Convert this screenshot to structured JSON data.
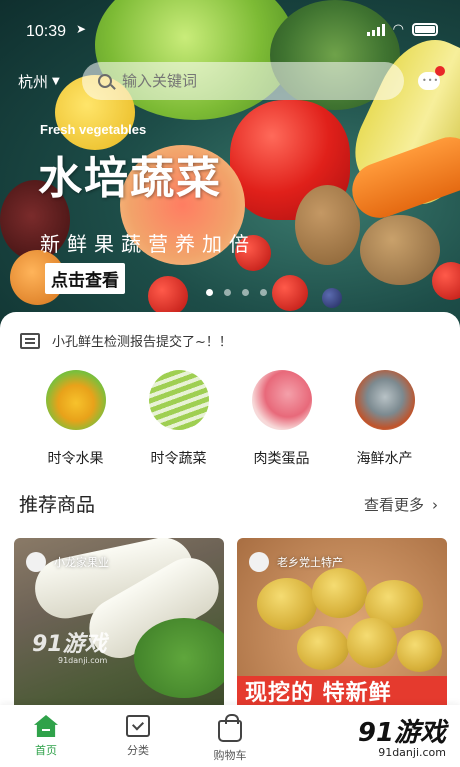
{
  "status_bar": {
    "time": "10:39"
  },
  "header": {
    "city": "杭州",
    "search_placeholder": "输入关键词"
  },
  "banner": {
    "eyebrow": "Fresh vegetables",
    "headline": "水培蔬菜",
    "subline": "新鲜果蔬营养加倍",
    "cta": "点击查看",
    "slide_count": 4,
    "active_slide": 1
  },
  "notice": {
    "text": "小孔鲜生检测报告提交了~！！"
  },
  "categories": [
    {
      "label": "时令水果",
      "icon": "fruit-image"
    },
    {
      "label": "时令蔬菜",
      "icon": "vegetable-image"
    },
    {
      "label": "肉类蛋品",
      "icon": "meat-egg-image"
    },
    {
      "label": "海鲜水产",
      "icon": "seafood-image"
    }
  ],
  "recommend": {
    "title": "推荐商品",
    "more": "查看更多",
    "products": [
      {
        "seller": "小龙家果业",
        "promo": ""
      },
      {
        "seller": "老乡党土特产",
        "promo": "现挖的 特新鲜"
      }
    ]
  },
  "watermarks": {
    "left_brand": "91游戏",
    "left_url": "91danji.com",
    "right_brand": "91游戏",
    "right_url": "91danji.com"
  },
  "tabs": [
    {
      "label": "首页",
      "active": true
    },
    {
      "label": "分类",
      "active": false
    },
    {
      "label": "购物车",
      "active": false
    }
  ],
  "colors": {
    "accent": "#2fa24a",
    "promo": "#e53a2e",
    "badge": "#e82828"
  }
}
